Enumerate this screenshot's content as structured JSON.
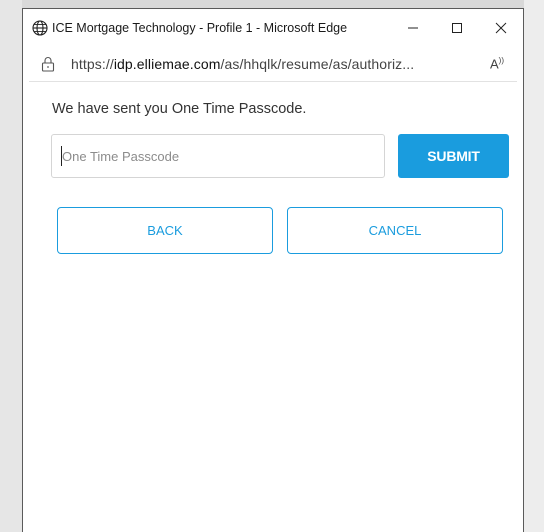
{
  "window": {
    "title": "ICE Mortgage Technology - Profile 1 - Microsoft Edge"
  },
  "address_bar": {
    "url_prefix": "https://",
    "url_domain": "idp.elliemae.com",
    "url_path": "/as/hhqlk/resume/as/authoriz..."
  },
  "content": {
    "message": "We have sent you One Time Passcode.",
    "otp_placeholder": "One Time Passcode",
    "otp_value": "",
    "submit_label": "SUBMIT",
    "back_label": "BACK",
    "cancel_label": "CANCEL"
  },
  "colors": {
    "accent": "#1a9cde",
    "window_border": "#5a5a5a"
  },
  "icons": {
    "title": "globe-icon",
    "address": "lock-icon",
    "read_aloud": "read-aloud-icon"
  }
}
